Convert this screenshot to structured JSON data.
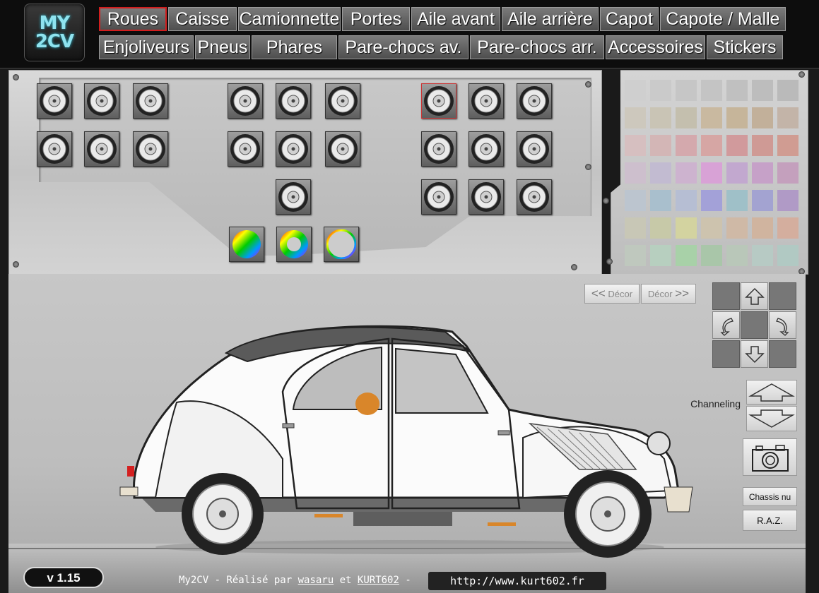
{
  "logo": {
    "text_line1": "MY",
    "text_line2": "2CV"
  },
  "nav": {
    "row1": [
      "Roues",
      "Caisse",
      "Camionnette",
      "Portes",
      "Aile avant",
      "Aile arrière",
      "Capot",
      "Capote / Malle"
    ],
    "row2": [
      "Enjoliveurs",
      "Pneus",
      "Phares",
      "Pare-chocs av.",
      "Pare-chocs arr.",
      "Accessoires",
      "Stickers"
    ],
    "active": "Roues"
  },
  "decor": {
    "prev_label": "Décor",
    "next_label": "Décor",
    "prev_arrows": "<<",
    "next_arrows": ">>"
  },
  "controls": {
    "channeling_label": "Channeling",
    "chassis_label": "Chassis nu",
    "reset_label": "R.A.Z."
  },
  "footer": {
    "version": "v 1.15",
    "credit_prefix": "My2CV - Réalisé par",
    "author1": "wasaru",
    "credit_mid": "et",
    "author2": "KURT602",
    "credit_suffix": "-",
    "url": "http://www.kurt602.fr"
  },
  "palette": [
    [
      "#cfcfcf",
      "#cacaca",
      "#c6c6c6",
      "#c4c4c4",
      "#c0c0c0",
      "#bdbdbd",
      "#bababa"
    ],
    [
      "#cdc8bd",
      "#c9c4b5",
      "#c4bfae",
      "#c9b9a0",
      "#c6b59a",
      "#c2b09a",
      "#c3b4a8"
    ],
    [
      "#d6bfc0",
      "#d3b6b6",
      "#d4a9ad",
      "#d6a6a4",
      "#d19a9c",
      "#cf9a95",
      "#d09c92"
    ],
    [
      "#cdbfcd",
      "#c2bbd1",
      "#cdb3cf",
      "#d8a2d6",
      "#c2a8cf",
      "#c6a1c8",
      "#c4a0bd"
    ],
    [
      "#bcc5cf",
      "#a9bfcd",
      "#b6bed3",
      "#a3a1d8",
      "#9fc0c8",
      "#a3a3d1",
      "#b09ac6"
    ],
    [
      "#c8c7b6",
      "#c7c9a8",
      "#d3d3a0",
      "#cdc3ae",
      "#cfb9a6",
      "#d0b49f",
      "#d4ae9e"
    ],
    [
      "#bfc8be",
      "#b7cfbf",
      "#a8d1a8",
      "#a9c6a9",
      "#b9c7b9",
      "#b7cac4",
      "#b1c9c3"
    ]
  ]
}
